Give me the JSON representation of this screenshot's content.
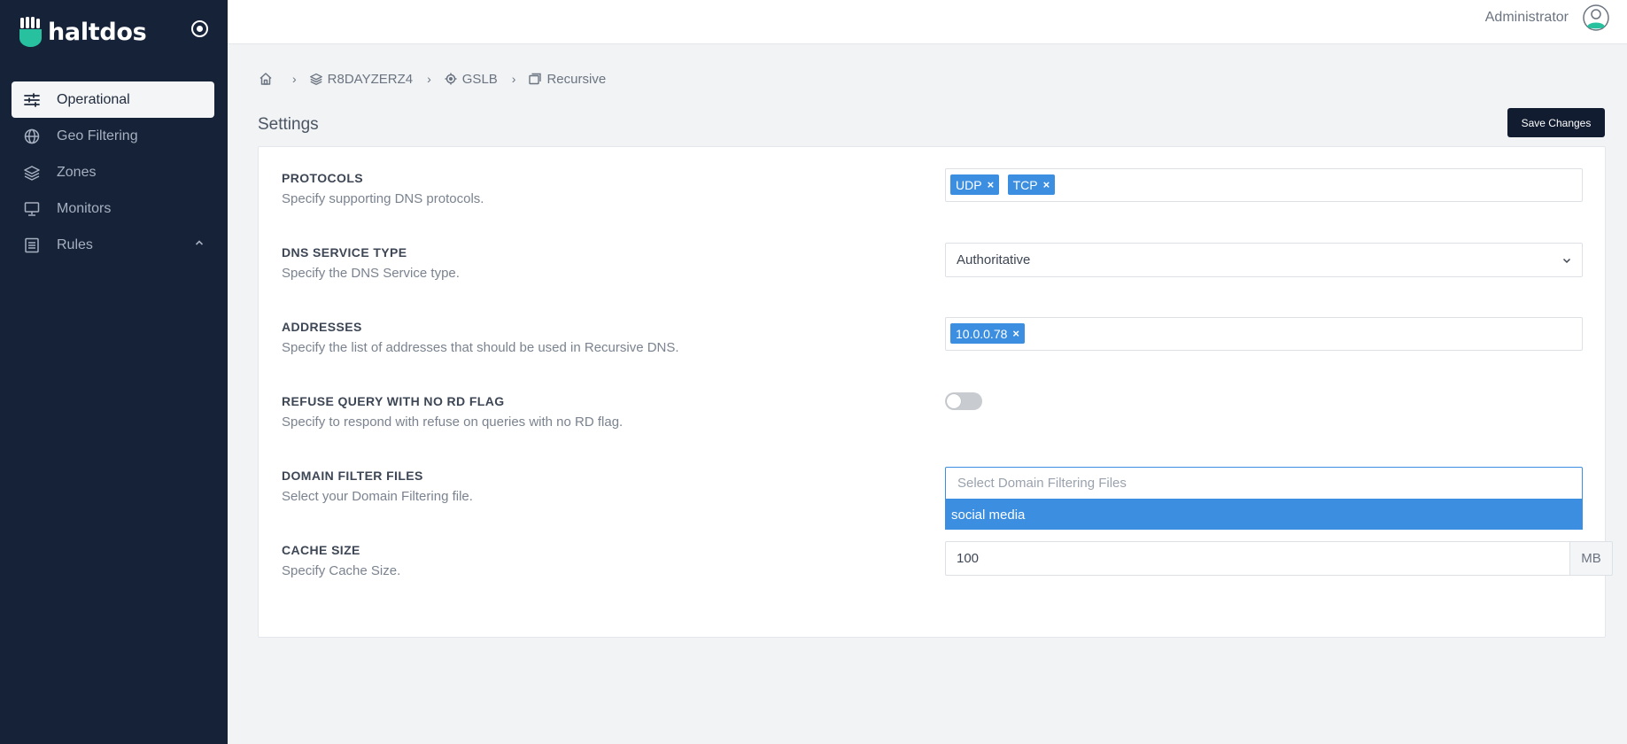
{
  "app": {
    "name": "haltdos"
  },
  "header": {
    "user_name": "Administrator"
  },
  "sidebar": {
    "items": [
      {
        "label": "Operational",
        "icon": "sliders-icon",
        "active": true
      },
      {
        "label": "Geo Filtering",
        "icon": "globe-icon"
      },
      {
        "label": "Zones",
        "icon": "layers-icon"
      },
      {
        "label": "Monitors",
        "icon": "monitor-icon"
      },
      {
        "label": "Rules",
        "icon": "list-icon",
        "expandable": true
      }
    ]
  },
  "breadcrumb": {
    "items": [
      {
        "label": "",
        "icon": "home-icon"
      },
      {
        "label": "R8DAYZERZ4",
        "icon": "layers-icon"
      },
      {
        "label": "GSLB",
        "icon": "target-icon"
      },
      {
        "label": "Recursive",
        "icon": "windows-icon"
      }
    ],
    "separator": "›"
  },
  "page": {
    "title": "Settings",
    "save_label": "Save Changes"
  },
  "settings": {
    "protocols": {
      "title": "PROTOCOLS",
      "description": "Specify supporting DNS protocols.",
      "tags": [
        "UDP",
        "TCP"
      ]
    },
    "service_type": {
      "title": "DNS SERVICE TYPE",
      "description": "Specify the DNS Service type.",
      "value": "Authoritative"
    },
    "addresses": {
      "title": "ADDRESSES",
      "description": "Specify the list of addresses that should be used in Recursive DNS.",
      "tags": [
        "10.0.0.78"
      ]
    },
    "refuse_query": {
      "title": "REFUSE QUERY WITH NO RD FLAG",
      "description": "Specify to respond with refuse on queries with no RD flag.",
      "enabled": false
    },
    "domain_filter": {
      "title": "DOMAIN FILTER FILES",
      "description": "Select your Domain Filtering file.",
      "placeholder": "Select Domain Filtering Files",
      "options": [
        "social media"
      ]
    },
    "cache_size": {
      "title": "CACHE SIZE",
      "description": "Specify Cache Size.",
      "value": "100",
      "unit": "MB"
    }
  },
  "colors": {
    "sidebar": "#152238",
    "accent": "#3b8ee0",
    "save_button": "#111c30"
  }
}
